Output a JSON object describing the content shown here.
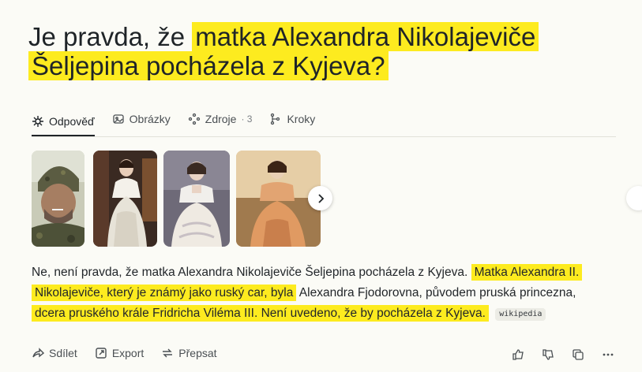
{
  "question": {
    "before": "Je pravda, že ",
    "highlight_line1": "matka Alexandra Nikolajeviče",
    "highlight_line2": "Šeljepina pocházela z Kyjeva?"
  },
  "tabs": [
    {
      "label": "Odpověď",
      "icon": "sparkle-icon"
    },
    {
      "label": "Obrázky",
      "icon": "image-icon"
    },
    {
      "label": "Zdroje",
      "count": "· 3",
      "icon": "sources-icon"
    },
    {
      "label": "Kroky",
      "icon": "steps-icon"
    }
  ],
  "answer": {
    "plain": "Ne, není pravda, že matka Alexandra Nikolajeviče Šeljepina pocházela z Kyjeva.",
    "hl_a": "Matka Alexandra II.",
    "hl_b": "Nikolajeviče, který je známý jako ruský car, byla",
    "plain2": "Alexandra Fjodorovna, původem pruská princezna,",
    "hl_c": "dcera pruského krále Fridricha Viléma III. Není uvedeno, že by pocházela z Kyjeva.",
    "citation": "wikipedia"
  },
  "actions": {
    "share": "Sdílet",
    "export": "Export",
    "rewrite": "Přepsat"
  },
  "colors": {
    "highlight": "#fdeb1f",
    "background": "#fbfbf6"
  }
}
